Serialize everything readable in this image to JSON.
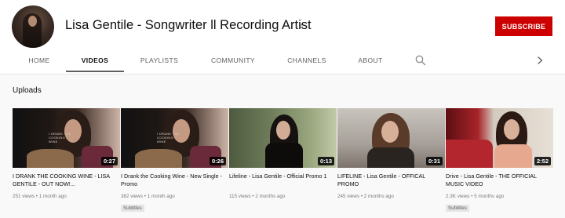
{
  "channel": {
    "name": "Lisa Gentile - Songwriter ll Recording Artist",
    "verified_mark": "♪",
    "subscribe_label": "SUBSCRIBE"
  },
  "tabs": [
    {
      "label": "HOME"
    },
    {
      "label": "VIDEOS"
    },
    {
      "label": "PLAYLISTS"
    },
    {
      "label": "COMMUNITY"
    },
    {
      "label": "CHANNELS"
    },
    {
      "label": "ABOUT"
    }
  ],
  "active_tab": "VIDEOS",
  "uploads": {
    "title": "Uploads",
    "videos": [
      {
        "title": "I DRANK THE COOKING WINE - LISA GENTILE - OUT NOW!...",
        "views": "251 views",
        "age": "1 month ago",
        "duration": "0:27",
        "badge": "",
        "thumb_text": "I DRANK THE COOKING WINE"
      },
      {
        "title": "I Drank the Cooking Wine - New Single - Promo",
        "views": "382 views",
        "age": "1 month ago",
        "duration": "0:26",
        "badge": "Subtitles",
        "thumb_text": "I DRANK THE COOKING WINE"
      },
      {
        "title": "Lifeline - Lisa Gentile - Official Promo 1",
        "views": "115 views",
        "age": "2 months ago",
        "duration": "0:13",
        "badge": ""
      },
      {
        "title": "LIFELINE - Lisa Gentile - OFFICAL PROMO",
        "views": "245 views",
        "age": "2 months ago",
        "duration": "0:31",
        "badge": ""
      },
      {
        "title": "Drive - Lisa Gentile - THE OFFICIAL MUSIC VIDEO",
        "views": "2.3K views",
        "age": "5 months ago",
        "duration": "2:52",
        "badge": "Subtitles"
      }
    ]
  },
  "colors": {
    "subscribe": "#cc0000",
    "background": "#f9f9f9"
  },
  "icons": {
    "search": "search-icon",
    "next": "chevron-right-icon"
  }
}
